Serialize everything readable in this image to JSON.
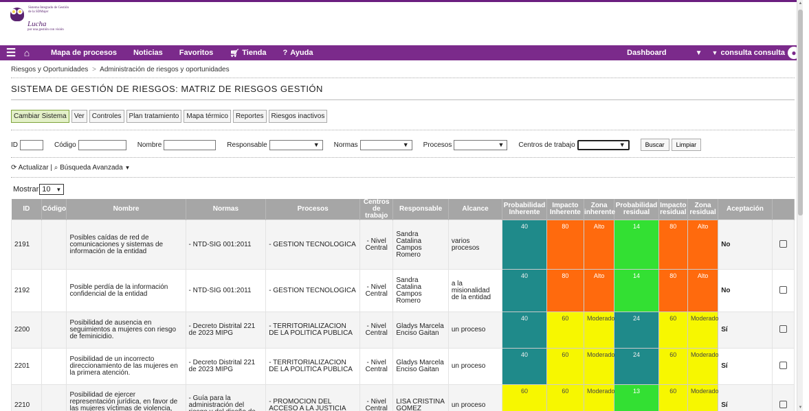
{
  "logo": {
    "small_text": "Sistema Integrado de Gestión de la SDMujer",
    "main_text": "Lucha",
    "sub_text": "por una gestión con visión"
  },
  "nav": {
    "items": [
      "Mapa de procesos",
      "Noticias",
      "Favoritos",
      "Tienda",
      "Ayuda"
    ],
    "dashboard": "Dashboard",
    "user": "consulta consulta"
  },
  "breadcrumb": {
    "root": "Riesgos y Oportunidades",
    "current": "Administración de riesgos y oportunidades"
  },
  "page_title": "SISTEMA DE GESTIÓN DE RIESGOS: MATRIZ DE RIESGOS GESTIÓN",
  "toolbar": [
    "Cambiar Sistema",
    "Ver",
    "Controles",
    "Plan tratamiento",
    "Mapa térmico",
    "Reportes",
    "Riesgos inactivos"
  ],
  "filters": {
    "id": "ID",
    "codigo": "Código",
    "nombre": "Nombre",
    "responsable": "Responsable",
    "normas": "Normas",
    "procesos": "Procesos",
    "centros": "Centros de trabajo",
    "buscar": "Buscar",
    "limpiar": "Limpiar"
  },
  "actions": {
    "actualizar": "Actualizar",
    "separator": "|",
    "busqueda": "Búsqueda Avanzada"
  },
  "mostrar": {
    "label": "Mostrar",
    "value": "10"
  },
  "table": {
    "headers": [
      "ID",
      "Código",
      "Nombre",
      "Normas",
      "Procesos",
      "Centros de trabajo",
      "Responsable",
      "Alcance",
      "Probabilidad Inherente",
      "Impacto Inherente",
      "Zona inherente",
      "Probabilidad residual",
      "Impacto residual",
      "Zona residual",
      "Aceptación",
      ""
    ],
    "rows": [
      {
        "id": "2191",
        "codigo": "",
        "nombre": "Posibles caídas de red de comunicaciones y sistemas de información de la entidad",
        "normas": "- NTD-SIG 001:2011",
        "procesos": "- GESTION TECNOLOGICA",
        "centros": "- Nivel Central",
        "responsable": "Sandra Catalina Campos Romero",
        "alcance": "varios procesos",
        "prob_inh": "40",
        "imp_inh": "80",
        "zona_inh": "Alto",
        "prob_res": "14",
        "imp_res": "80",
        "zona_res": "Alto",
        "aceptacion": "No"
      },
      {
        "id": "2192",
        "codigo": "",
        "nombre": "Posible perdía de la información confidencial de la entidad",
        "normas": "- NTD-SIG 001:2011",
        "procesos": "- GESTION TECNOLOGICA",
        "centros": "- Nivel Central",
        "responsable": "Sandra Catalina Campos Romero",
        "alcance": "a la misionalidad de la entidad",
        "prob_inh": "40",
        "imp_inh": "80",
        "zona_inh": "Alto",
        "prob_res": "14",
        "imp_res": "80",
        "zona_res": "Alto",
        "aceptacion": "No"
      },
      {
        "id": "2200",
        "codigo": "",
        "nombre": "Posibilidad de ausencia en seguimientos a mujeres con riesgo de feminicidio.",
        "normas": "- Decreto Distrital 221 de 2023 MIPG",
        "procesos": "- TERRITORIALIZACION DE LA POLITICA PUBLICA",
        "centros": "- Nivel Central",
        "responsable": "Gladys Marcela Enciso Gaitan",
        "alcance": "un proceso",
        "prob_inh": "40",
        "imp_inh": "60",
        "zona_inh": "Moderado",
        "prob_res": "24",
        "imp_res": "60",
        "zona_res": "Moderado",
        "aceptacion": "Sí"
      },
      {
        "id": "2201",
        "codigo": "",
        "nombre": "Posibilidad de un incorrecto direccionamiento de las mujeres en la primera atención.",
        "normas": "- Decreto Distrital 221 de 2023 MIPG",
        "procesos": "- TERRITORIALIZACION DE LA POLITICA PUBLICA",
        "centros": "- Nivel Central",
        "responsable": "Gladys Marcela Enciso Gaitan",
        "alcance": "un proceso",
        "prob_inh": "40",
        "imp_inh": "60",
        "zona_inh": "Moderado",
        "prob_res": "24",
        "imp_res": "60",
        "zona_res": "Moderado",
        "aceptacion": "Sí"
      },
      {
        "id": "2210",
        "codigo": "",
        "nombre": "Posibilidad de ejercer representación jurídica, en favor de las mujeres víctimas de violencia, sin el",
        "normas": "- Guía para la administración del riesgo y del diseño de",
        "procesos": "- PROMOCION DEL ACCESO A LA JUSTICIA",
        "centros": "- Nivel Central",
        "responsable": "LISA CRISTINA GOMEZ",
        "alcance": "un proceso",
        "prob_inh": "60",
        "imp_inh": "60",
        "zona_inh": "Moderado",
        "prob_res": "13",
        "imp_res": "60",
        "zona_res": "Moderado",
        "aceptacion": "Sí"
      }
    ]
  },
  "colors": {
    "nav_bg": "#7b2a8b",
    "teal": "#1f8a8a",
    "orange": "#ff6a0d",
    "green": "#33e033",
    "yellow": "#f7f700"
  }
}
